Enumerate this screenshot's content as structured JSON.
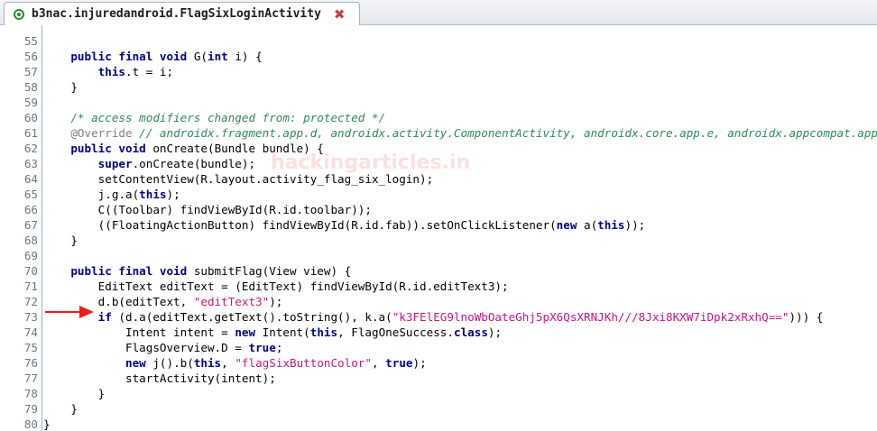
{
  "tab": {
    "title": "b3nac.injuredandroid.FlagSixLoginActivity",
    "close_glyph": "✖",
    "icon": "class-icon"
  },
  "watermark": "hackingarticles.in",
  "colors": {
    "keyword": "#00008b",
    "comment": "#2e8b57",
    "string": "#c71585",
    "annotation": "#808080",
    "line_number": "#6e7680",
    "arrow": "#ee1c1c"
  },
  "annotation_arrow": {
    "points_to_line": "73"
  },
  "lines": [
    {
      "n": "55",
      "tokens": []
    },
    {
      "n": "56",
      "tokens": [
        {
          "t": "kw",
          "v": "    public final void "
        },
        {
          "t": "",
          "v": "G("
        },
        {
          "t": "kw",
          "v": "int"
        },
        {
          "t": "",
          "v": " i) {"
        }
      ]
    },
    {
      "n": "57",
      "tokens": [
        {
          "t": "kw",
          "v": "        this"
        },
        {
          "t": "",
          "v": ".t = i;"
        }
      ]
    },
    {
      "n": "58",
      "tokens": [
        {
          "t": "",
          "v": "    }"
        }
      ]
    },
    {
      "n": "59",
      "tokens": []
    },
    {
      "n": "60",
      "tokens": [
        {
          "t": "cm",
          "v": "    /* access modifiers changed from: protected */"
        }
      ]
    },
    {
      "n": "61",
      "tokens": [
        {
          "t": "an",
          "v": "    @Override"
        },
        {
          "t": "cm",
          "v": " // androidx.fragment.app.d, androidx.activity.ComponentActivity, androidx.core.app.e, androidx.appcompat.app.c"
        }
      ]
    },
    {
      "n": "62",
      "tokens": [
        {
          "t": "kw",
          "v": "    public void "
        },
        {
          "t": "",
          "v": "onCreate(Bundle bundle) {"
        }
      ]
    },
    {
      "n": "63",
      "tokens": [
        {
          "t": "kw",
          "v": "        super"
        },
        {
          "t": "",
          "v": ".onCreate(bundle);"
        }
      ]
    },
    {
      "n": "64",
      "tokens": [
        {
          "t": "",
          "v": "        setContentView(R.layout.activity_flag_six_login);"
        }
      ]
    },
    {
      "n": "65",
      "tokens": [
        {
          "t": "",
          "v": "        j.g.a("
        },
        {
          "t": "kw",
          "v": "this"
        },
        {
          "t": "",
          "v": ");"
        }
      ]
    },
    {
      "n": "66",
      "tokens": [
        {
          "t": "",
          "v": "        C((Toolbar) findViewById(R.id.toolbar));"
        }
      ]
    },
    {
      "n": "67",
      "tokens": [
        {
          "t": "",
          "v": "        ((FloatingActionButton) findViewById(R.id.fab)).setOnClickListener("
        },
        {
          "t": "kw",
          "v": "new"
        },
        {
          "t": "",
          "v": " a("
        },
        {
          "t": "kw",
          "v": "this"
        },
        {
          "t": "",
          "v": "));"
        }
      ]
    },
    {
      "n": "68",
      "tokens": [
        {
          "t": "",
          "v": "    }"
        }
      ]
    },
    {
      "n": "69",
      "tokens": []
    },
    {
      "n": "70",
      "tokens": [
        {
          "t": "kw",
          "v": "    public final void "
        },
        {
          "t": "",
          "v": "submitFlag(View view) {"
        }
      ]
    },
    {
      "n": "71",
      "tokens": [
        {
          "t": "",
          "v": "        EditText editText = (EditText) findViewById(R.id.editText3);"
        }
      ]
    },
    {
      "n": "72",
      "tokens": [
        {
          "t": "",
          "v": "        d.b(editText, "
        },
        {
          "t": "st",
          "v": "\"editText3\""
        },
        {
          "t": "",
          "v": ");"
        }
      ]
    },
    {
      "n": "73",
      "tokens": [
        {
          "t": "kw",
          "v": "        if"
        },
        {
          "t": "",
          "v": " (d.a(editText.getText().toString(), k.a("
        },
        {
          "t": "st",
          "v": "\"k3FElEG9lnoWbOateGhj5pX6QsXRNJKh///8Jxi8KXW7iDpk2xRxhQ==\""
        },
        {
          "t": "",
          "v": "))) {"
        }
      ]
    },
    {
      "n": "74",
      "tokens": [
        {
          "t": "",
          "v": "            Intent intent = "
        },
        {
          "t": "kw",
          "v": "new"
        },
        {
          "t": "",
          "v": " Intent("
        },
        {
          "t": "kw",
          "v": "this"
        },
        {
          "t": "",
          "v": ", FlagOneSuccess."
        },
        {
          "t": "kw",
          "v": "class"
        },
        {
          "t": "",
          "v": ");"
        }
      ]
    },
    {
      "n": "75",
      "tokens": [
        {
          "t": "",
          "v": "            FlagsOverview.D = "
        },
        {
          "t": "kw",
          "v": "true"
        },
        {
          "t": "",
          "v": ";"
        }
      ]
    },
    {
      "n": "76",
      "tokens": [
        {
          "t": "kw",
          "v": "            new"
        },
        {
          "t": "",
          "v": " j().b("
        },
        {
          "t": "kw",
          "v": "this"
        },
        {
          "t": "",
          "v": ", "
        },
        {
          "t": "st",
          "v": "\"flagSixButtonColor\""
        },
        {
          "t": "",
          "v": ", "
        },
        {
          "t": "kw",
          "v": "true"
        },
        {
          "t": "",
          "v": ");"
        }
      ]
    },
    {
      "n": "77",
      "tokens": [
        {
          "t": "",
          "v": "            startActivity(intent);"
        }
      ]
    },
    {
      "n": "78",
      "tokens": [
        {
          "t": "",
          "v": "        }"
        }
      ]
    },
    {
      "n": "79",
      "tokens": [
        {
          "t": "",
          "v": "    }"
        }
      ]
    },
    {
      "n": "80",
      "tokens": [
        {
          "t": "",
          "v": "}"
        }
      ]
    }
  ]
}
